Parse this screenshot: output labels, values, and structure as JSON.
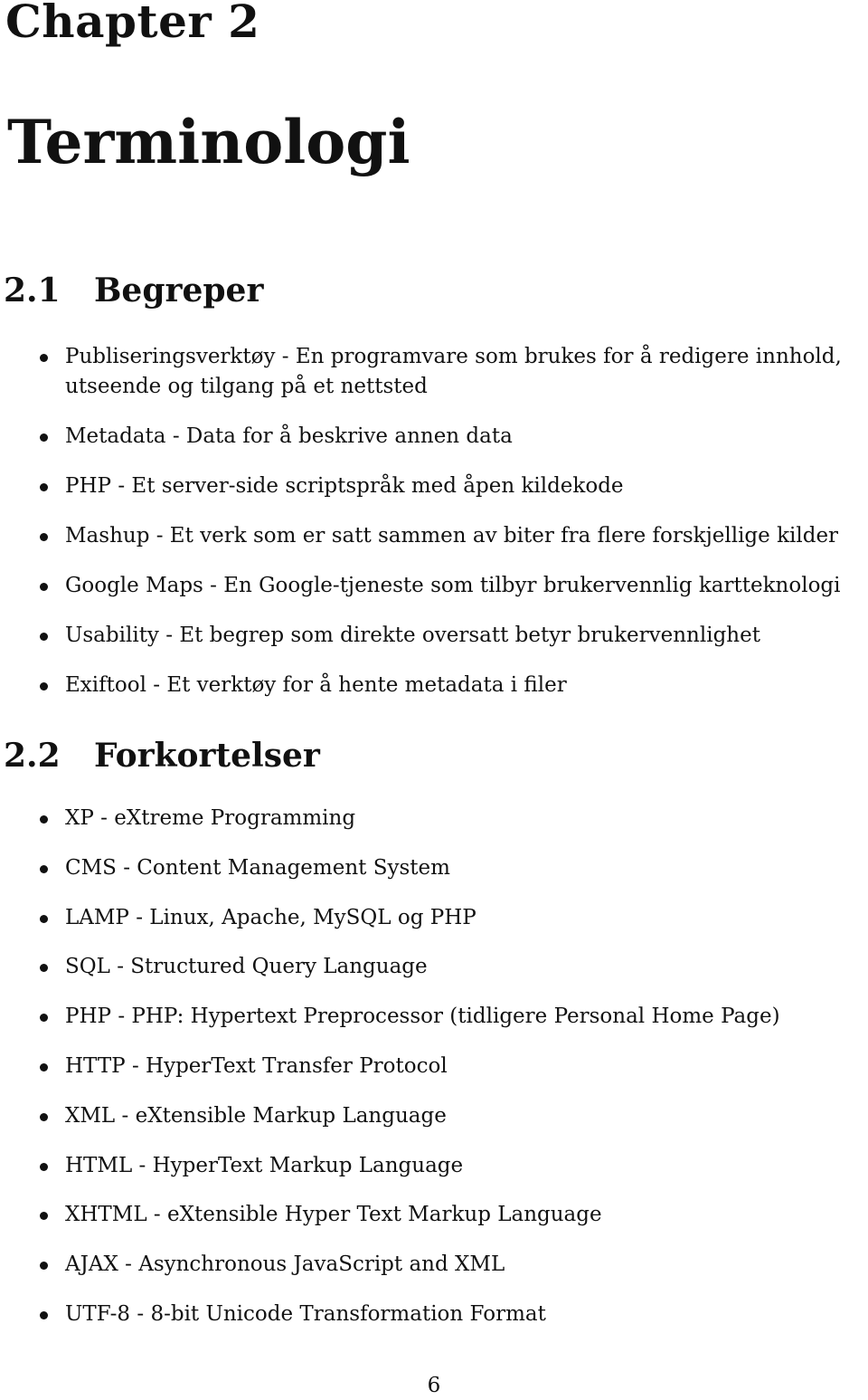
{
  "chapter": {
    "label": "Chapter 2",
    "title": "Terminologi"
  },
  "sections": [
    {
      "number": "2.1",
      "title": "Begreper",
      "items": [
        "Publiseringsverktøy - En programvare som brukes for å redigere innhold,\nutseende og tilgang på et nettsted",
        "Metadata - Data for å beskrive annen data",
        "PHP - Et server-side scriptspråk med åpen kildekode",
        "Mashup - Et verk som er satt sammen av biter fra flere forskjellige kilder",
        "Google Maps - En Google-tjeneste som tilbyr brukervennlig kartteknologi",
        "Usability - Et begrep som direkte oversatt betyr brukervennlighet",
        "Exiftool - Et verktøy for å hente metadata i filer"
      ]
    },
    {
      "number": "2.2",
      "title": "Forkortelser",
      "items": [
        "XP - eXtreme Programming",
        "CMS - Content Management System",
        "LAMP - Linux, Apache, MySQL og PHP",
        "SQL - Structured Query Language",
        "PHP - PHP: Hypertext Preprocessor (tidligere Personal Home Page)",
        "HTTP - HyperText Transfer Protocol",
        "XML - eXtensible Markup Language",
        "HTML - HyperText Markup Language",
        "XHTML - eXtensible Hyper Text Markup Language",
        "AJAX - Asynchronous JavaScript and XML",
        "UTF-8 - 8-bit Unicode Transformation Format"
      ]
    }
  ],
  "page_number": "6"
}
